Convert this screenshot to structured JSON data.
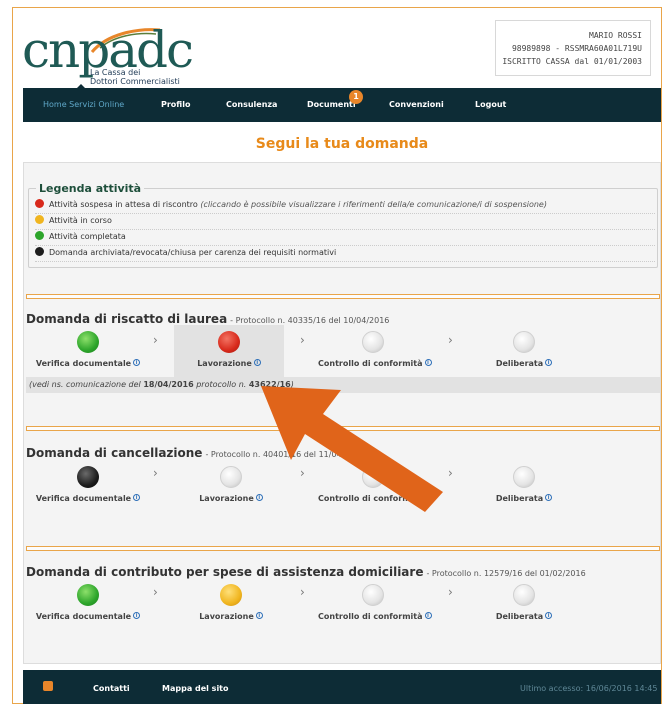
{
  "logo": {
    "word": "cnpadc",
    "sub1": "La Cassa dei",
    "sub2": "Dottori Commercialisti"
  },
  "user": {
    "name": "MARIO ROSSI",
    "code": "98989898 - RSSMRA60A01L719U",
    "enrolled": "ISCRITTO CASSA dal 01/01/2003"
  },
  "nav": {
    "items": [
      "Home Servizi Online",
      "Profilo",
      "Consulenza",
      "Documenti",
      "Convenzioni",
      "Logout"
    ],
    "badge": "1"
  },
  "page_title": "Segui la tua domanda",
  "legend": {
    "title": "Legenda attività",
    "rows": [
      {
        "text": "Attività sospesa in attesa di riscontro",
        "note": "(cliccando è possibile visualizzare i riferimenti della/e comunicazione/i di sospensione)",
        "color": "#d8291b"
      },
      {
        "text": "Attività in corso",
        "note": "",
        "color": "#f0b51f"
      },
      {
        "text": "Attività completata",
        "note": "",
        "color": "#2da52b"
      },
      {
        "text": "Domanda archiviata/revocata/chiusa per carenza dei requisiti normativi",
        "note": "",
        "color": "#1d1d1d"
      }
    ]
  },
  "steps": [
    "Verifica documentale",
    "Lavorazione",
    "Controllo di conformità",
    "Deliberata"
  ],
  "requests": [
    {
      "title": "Domanda di riscatto di laurea",
      "protocol": "- Protocollo n. 40335/16 del 10/04/2016",
      "states": [
        "green",
        "red",
        "grey",
        "grey"
      ],
      "communication": {
        "pre": "(vedi ns. comunicazione del ",
        "date": "18/04/2016",
        "mid": " protocollo n. ",
        "proto": "43622/16",
        "post": ")"
      }
    },
    {
      "title": "Domanda di cancellazione",
      "protocol": "- Protocollo n. 40401/16 del 11/04/2016",
      "states": [
        "black",
        "grey",
        "grey",
        "grey"
      ]
    },
    {
      "title": "Domanda di contributo per spese di assistenza domiciliare",
      "protocol": "- Protocollo n. 12579/16 del 01/02/2016",
      "states": [
        "green",
        "orange",
        "grey",
        "grey"
      ]
    }
  ],
  "footer": {
    "contacts": "Contatti",
    "sitemap": "Mappa del sito",
    "last_access": "Ultimo accesso: 16/06/2016 14:45"
  },
  "colors": {
    "accent": "#e88a1a",
    "nav_bg": "#0d2c36",
    "arrow": "#e0641a"
  },
  "icons": {
    "rss": "rss-icon",
    "info": "info-icon",
    "arrow": "pointer-arrow"
  }
}
